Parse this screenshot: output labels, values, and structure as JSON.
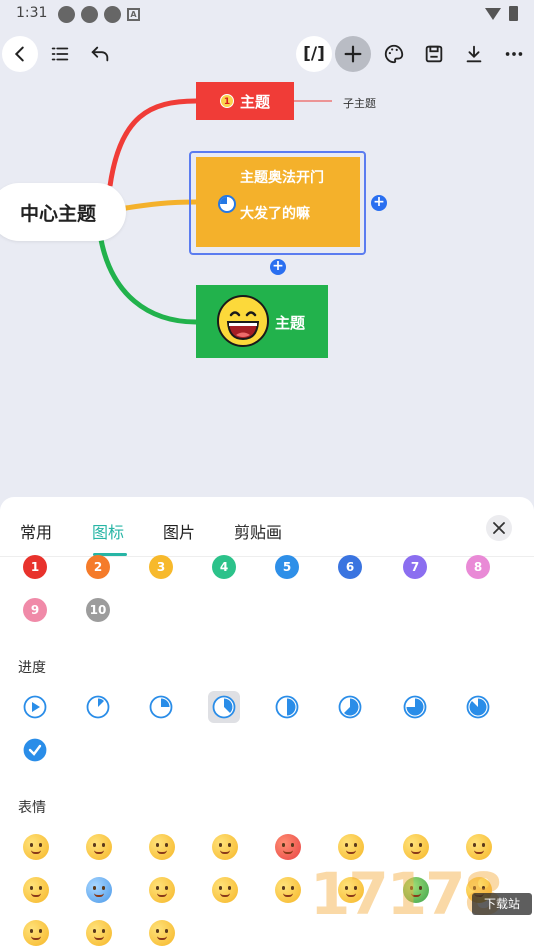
{
  "status_bar": {
    "time": "1:31"
  },
  "toolbar": {
    "back_icon": "back-arrow-icon",
    "outline_icon": "outline-list-icon",
    "undo_icon": "undo-icon",
    "formula_label": "[/]",
    "add_icon": "plus-icon",
    "theme_icon": "palette-icon",
    "save_icon": "save-icon",
    "download_icon": "download-icon",
    "more_icon": "more-icon"
  },
  "mindmap": {
    "center_topic": "中心主题",
    "node_red": {
      "badge": "1",
      "label": "主题"
    },
    "subtopic_label": "子主题",
    "node_yellow": {
      "line1": "主题奥法开门",
      "line2": "大发了的嘛"
    },
    "node_green": {
      "label": "主题"
    },
    "colors": {
      "red": "#f03c37",
      "yellow": "#f4b12b",
      "green": "#22b24c",
      "selection": "#5b7cf0"
    }
  },
  "panel": {
    "tabs": [
      {
        "label": "常用"
      },
      {
        "label": "图标"
      },
      {
        "label": "图片"
      },
      {
        "label": "剪贴画"
      }
    ],
    "active_tab": "图标",
    "close_icon": "close-icon",
    "numbers": [
      "1",
      "2",
      "3",
      "4",
      "5",
      "6",
      "7",
      "8",
      "9",
      "10"
    ],
    "number_colors": [
      "#e8322c",
      "#f57b2a",
      "#f7b92c",
      "#2cc28a",
      "#2e8fe8",
      "#3a74e0",
      "#8b6ef0",
      "#e98ad6",
      "#f08aa8",
      "#9c9c9c"
    ],
    "progress_title": "进度",
    "progress_values": [
      0,
      12.5,
      25,
      37.5,
      50,
      62.5,
      75,
      87.5,
      100
    ],
    "emoji_title": "表情",
    "emoji_icons": [
      "smile-icon",
      "grin-icon",
      "glasses-icon",
      "worried-icon",
      "angry-icon",
      "crying-icon",
      "surprised-icon",
      "confused-icon",
      "sweat-icon",
      "cold-icon",
      "sad-icon",
      "laugh-icon",
      "dizzy-icon",
      "love-icon",
      "sick-icon",
      "nervous-icon",
      "tongue-icon",
      "cool-icon",
      "smirk-icon"
    ]
  },
  "watermark": {
    "text": "17178",
    "tag": "下载站"
  }
}
